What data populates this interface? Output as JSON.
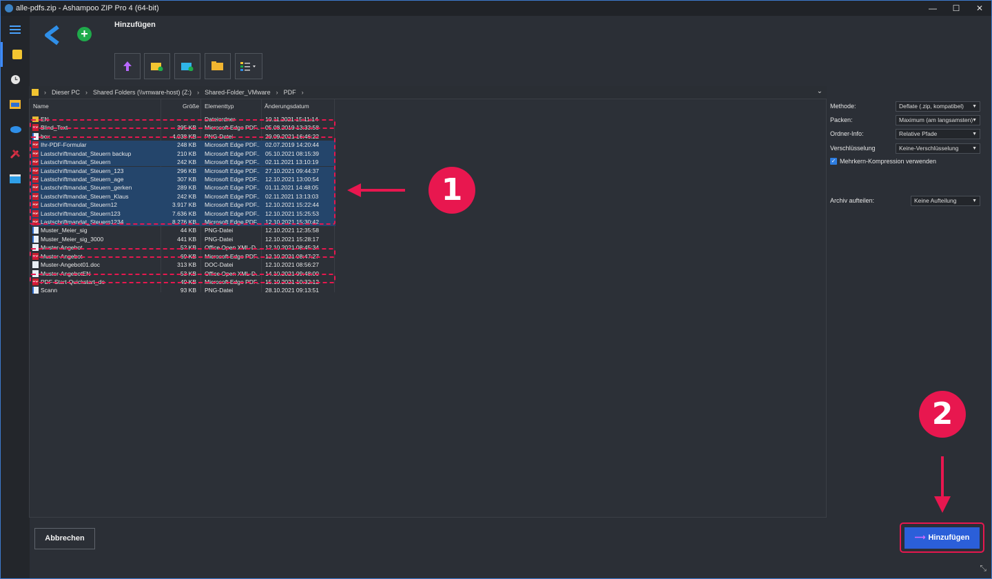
{
  "window": {
    "title": "alle-pdfs.zip - Ashampoo ZIP Pro 4 (64-bit)",
    "controls": [
      "—",
      "☐",
      "✕"
    ]
  },
  "header": {
    "title": "Hinzufügen"
  },
  "toolbar": {
    "buttons": [
      "up-arrow-icon",
      "new-folder-icon",
      "folder-add-icon",
      "open-folder-icon",
      "view-options-icon"
    ]
  },
  "breadcrumb": [
    "Dieser PC",
    "Shared Folders (\\\\vmware-host) (Z:)",
    "Shared-Folder_VMware",
    "PDF"
  ],
  "columns": {
    "name": "Name",
    "size": "Größe",
    "type": "Elementtyp",
    "date": "Änderungsdatum"
  },
  "files": [
    {
      "name": "EN",
      "size": "",
      "type": "Dateiordner",
      "date": "10.11.2021 15:11:14",
      "icon": "folder",
      "selected": false
    },
    {
      "name": "Blind_Text",
      "size": "395 KB",
      "type": "Microsoft Edge PDF...",
      "date": "05.08.2019 13:33:58",
      "icon": "pdf",
      "selected": false
    },
    {
      "name": "box",
      "size": "4.038 KB",
      "type": "PNG-Datei",
      "date": "29.09.2021 16:46:22",
      "icon": "png",
      "selected": false
    },
    {
      "name": "Ihr-PDF-Formular",
      "size": "248 KB",
      "type": "Microsoft Edge PDF...",
      "date": "02.07.2019 14:20:44",
      "icon": "pdf",
      "selected": true
    },
    {
      "name": "Lastschriftmandat_Steuern backup",
      "size": "210 KB",
      "type": "Microsoft Edge PDF...",
      "date": "05.10.2021 08:15:39",
      "icon": "pdf",
      "selected": true
    },
    {
      "name": "Lastschriftmandat_Steuern",
      "size": "242 KB",
      "type": "Microsoft Edge PDF...",
      "date": "02.11.2021 13:10:19",
      "icon": "pdf",
      "selected": true
    },
    {
      "name": "Lastschriftmandat_Steuern_123",
      "size": "296 KB",
      "type": "Microsoft Edge PDF...",
      "date": "27.10.2021 09:44:37",
      "icon": "pdf",
      "selected": true
    },
    {
      "name": "Lastschriftmandat_Steuern_age",
      "size": "307 KB",
      "type": "Microsoft Edge PDF...",
      "date": "12.10.2021 13:00:54",
      "icon": "pdf",
      "selected": true
    },
    {
      "name": "Lastschriftmandat_Steuern_gerken",
      "size": "289 KB",
      "type": "Microsoft Edge PDF...",
      "date": "01.11.2021 14:48:05",
      "icon": "pdf",
      "selected": true
    },
    {
      "name": "Lastschriftmandat_Steuern_Klaus",
      "size": "242 KB",
      "type": "Microsoft Edge PDF...",
      "date": "02.11.2021 13:13:03",
      "icon": "pdf",
      "selected": true
    },
    {
      "name": "Lastschriftmandat_Steuern12",
      "size": "3.917 KB",
      "type": "Microsoft Edge PDF...",
      "date": "12.10.2021 15:22:44",
      "icon": "pdf",
      "selected": true
    },
    {
      "name": "Lastschriftmandat_Steuern123",
      "size": "7.636 KB",
      "type": "Microsoft Edge PDF...",
      "date": "12.10.2021 15:25:53",
      "icon": "pdf",
      "selected": true
    },
    {
      "name": "Lastschriftmandat_Steuern1234",
      "size": "8.276 KB",
      "type": "Microsoft Edge PDF...",
      "date": "12.10.2021 15:30:42",
      "icon": "pdf",
      "selected": true
    },
    {
      "name": "Muster_Meier_sig",
      "size": "44 KB",
      "type": "PNG-Datei",
      "date": "12.10.2021 12:35:58",
      "icon": "png",
      "selected": false
    },
    {
      "name": "Muster_Meier_sig_3000",
      "size": "441 KB",
      "type": "PNG-Datei",
      "date": "12.10.2021 15:28:17",
      "icon": "png",
      "selected": false
    },
    {
      "name": "Muster-Angebot",
      "size": "52 KB",
      "type": "Office Open XML-D...",
      "date": "12.10.2021 08:45:34",
      "icon": "doc",
      "selected": false
    },
    {
      "name": "Muster-Angebot",
      "size": "69 KB",
      "type": "Microsoft Edge PDF...",
      "date": "12.10.2021 08:47:27",
      "icon": "pdf",
      "selected": false
    },
    {
      "name": "Muster-Angebot01.doc",
      "size": "313 KB",
      "type": "DOC-Datei",
      "date": "12.10.2021 08:56:27",
      "icon": "doc",
      "selected": false
    },
    {
      "name": "Muster-AngebotEN",
      "size": "53 KB",
      "type": "Office Open XML-D...",
      "date": "14.10.2021 09:48:00",
      "icon": "doc",
      "selected": false
    },
    {
      "name": "PDF-Start-Quickstart_de",
      "size": "49 KB",
      "type": "Microsoft Edge PDF...",
      "date": "15.10.2021 10:32:12",
      "icon": "pdf",
      "selected": false
    },
    {
      "name": "Scann",
      "size": "93 KB",
      "type": "PNG-Datei",
      "date": "28.10.2021 09:13:51",
      "icon": "png",
      "selected": false
    }
  ],
  "options": {
    "method_label": "Methode:",
    "method_value": "Deflate (.zip, kompatibel)",
    "pack_label": "Packen:",
    "pack_value": "Maximum (am langsamsten)",
    "folder_label": "Ordner-Info:",
    "folder_value": "Relative Pfade",
    "encrypt_label": "Verschlüsselung",
    "encrypt_value": "Keine-Verschlüsselung",
    "multicore_label": "Mehrkern-Kompression verwenden",
    "multicore_checked": true,
    "split_label": "Archiv aufteilen:",
    "split_value": "Keine Aufteilung"
  },
  "annotations": {
    "badge1": "1",
    "badge2": "2",
    "color": "#e8174f"
  },
  "buttons": {
    "cancel": "Abbrechen",
    "add": "Hinzufügen"
  },
  "colors": {
    "accent": "#2b5fd9",
    "selection": "#24456b",
    "background": "#2b2f36"
  }
}
